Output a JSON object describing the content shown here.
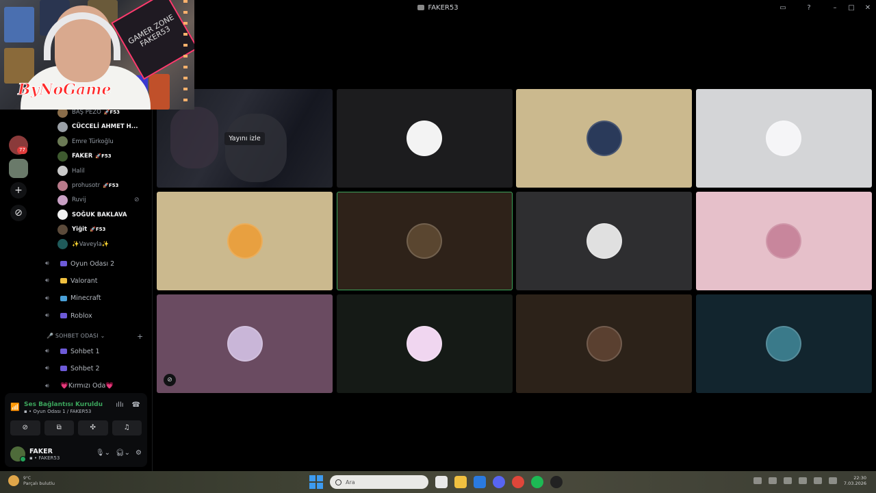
{
  "window": {
    "title": "FAKER53"
  },
  "webcam": {
    "neon_text": "GAMER ZONE FAKER53",
    "watermark": "ByNoGame"
  },
  "rail": {
    "badge_count": "77",
    "add_label": "+",
    "explore_label": "⊘"
  },
  "members": [
    {
      "name": "BAŞ PEZO",
      "tag": "🚀F53",
      "bold": false,
      "color": "#8a6d4a"
    },
    {
      "name": "CÜCCELİ AHMET H...",
      "tag": "",
      "bold": true,
      "color": "#9aa0a6"
    },
    {
      "name": "Emre Türkoğlu",
      "tag": "",
      "bold": false,
      "color": "#6b7a55"
    },
    {
      "name": "FAKER",
      "tag": "🚀F53",
      "bold": true,
      "color": "#3e5a2f"
    },
    {
      "name": "Halil",
      "tag": "",
      "bold": false,
      "color": "#c9c9c9"
    },
    {
      "name": "prohusotr",
      "tag": "🚀F53",
      "bold": false,
      "color": "#b87a8a"
    },
    {
      "name": "Ruvij",
      "tag": "",
      "bold": false,
      "color": "#c9a0c4",
      "muted": true
    },
    {
      "name": "SOĞUK BAKLAVA",
      "tag": "",
      "bold": true,
      "color": "#f1f1f1"
    },
    {
      "name": "Yiğit",
      "tag": "🚀F53",
      "bold": true,
      "color": "#5b4a3a"
    },
    {
      "name": "✨Vaveyla✨",
      "tag": "",
      "bold": false,
      "color": "#1f5a5a"
    }
  ],
  "voice_channels": [
    {
      "label": "Oyun Odası 2",
      "color": "#6d5ad8"
    },
    {
      "label": "Valorant",
      "color": "#f0c040"
    },
    {
      "label": "Minecraft",
      "color": "#4aa0d8"
    },
    {
      "label": "Roblox",
      "color": "#6d5ad8"
    }
  ],
  "category": {
    "label": "🎤 SOHBET ODASI ⌄",
    "plus": "+"
  },
  "chat_channels": [
    {
      "label": "Sohbet 1",
      "color": "#6d5ad8"
    },
    {
      "label": "Sohbet 2",
      "color": "#6d5ad8"
    },
    {
      "label": "💗Kırmızı Oda💗",
      "color": ""
    }
  ],
  "connection": {
    "status": "Ses Bağlantısı Kuruldu",
    "channel": "▪ • Oyun Odası 1 / FAKER53"
  },
  "user": {
    "name": "FAKER",
    "server_tag": "▪ • FAKER53"
  },
  "stream_tile": {
    "watch_label": "Yayını izle"
  },
  "tiles": [
    {
      "bg": "#1c1c1e",
      "avatar": "#f3f3f3",
      "speaking": false,
      "muted": false
    },
    {
      "bg": "#cbb98e",
      "avatar": "#2a3a5a",
      "speaking": false,
      "muted": false
    },
    {
      "bg": "#d4d5d7",
      "avatar": "#f5f5f7",
      "speaking": false,
      "muted": false
    },
    {
      "bg": "#cbb98e",
      "avatar": "#e8a040",
      "speaking": false,
      "muted": false
    },
    {
      "bg": "#2e2219",
      "avatar": "#5a4630",
      "speaking": true,
      "muted": false
    },
    {
      "bg": "#2e2e30",
      "avatar": "#e0e0e0",
      "speaking": false,
      "muted": false
    },
    {
      "bg": "#e6c0ca",
      "avatar": "#c8869c",
      "speaking": false,
      "muted": false
    },
    {
      "bg": "#6a4b61",
      "avatar": "#c9b6d8",
      "speaking": false,
      "muted": true
    },
    {
      "bg": "#151a16",
      "avatar": "#f0d6f0",
      "speaking": false,
      "muted": false
    },
    {
      "bg": "#2c2219",
      "avatar": "#5a4030",
      "speaking": false,
      "muted": false
    },
    {
      "bg": "#12252e",
      "avatar": "#3a7a8a",
      "speaking": false,
      "muted": false
    }
  ],
  "taskbar": {
    "weather_temp": "9°C",
    "weather_desc": "Parçalı bulutlu",
    "search_placeholder": "Ara",
    "time": "22:30",
    "date": "7.03.2026"
  },
  "colors": {
    "speaking": "#3ba55c",
    "accent": "#5865f2"
  }
}
